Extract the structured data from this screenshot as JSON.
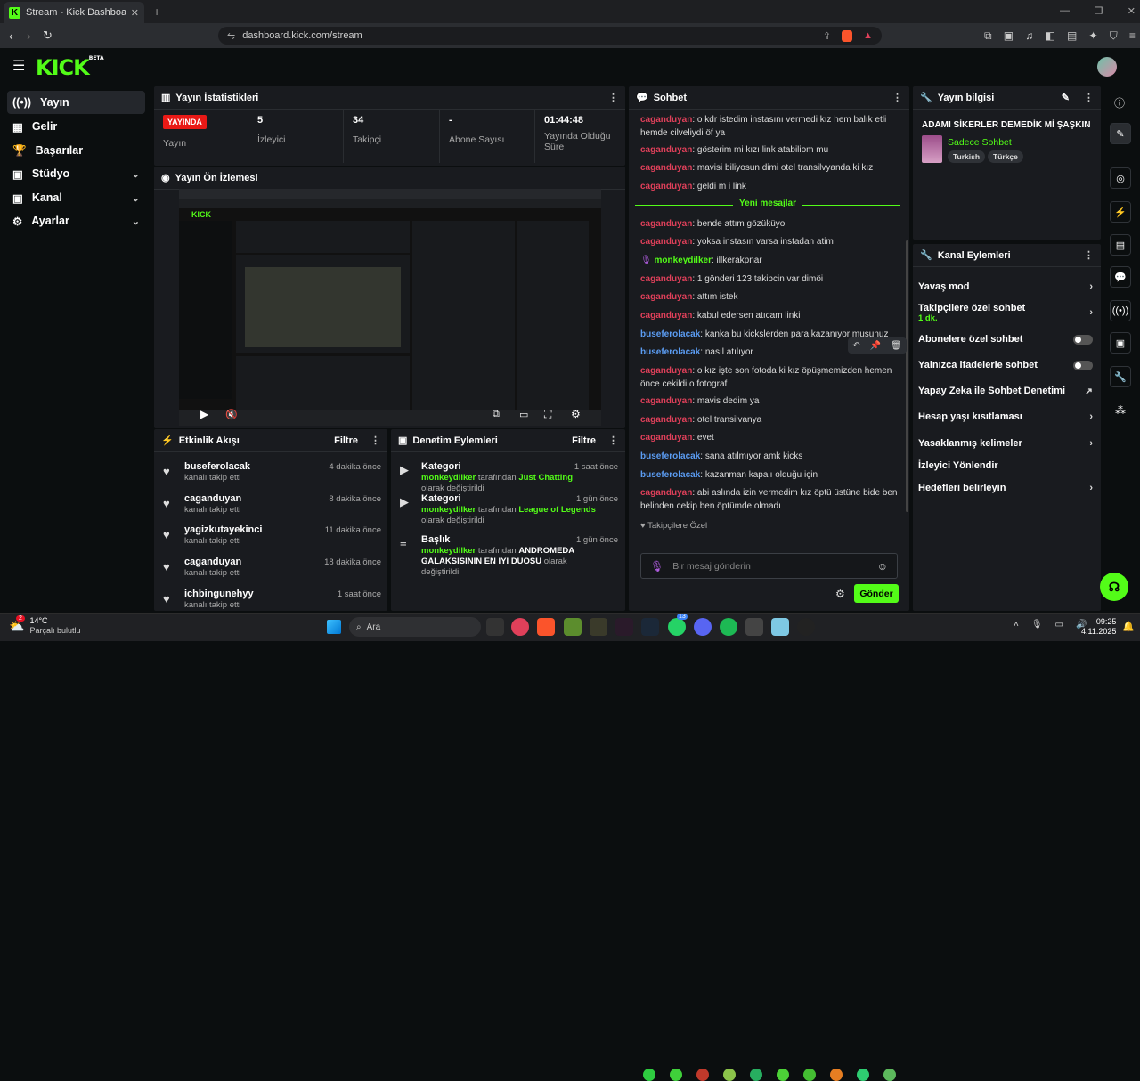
{
  "browser": {
    "tab_title": "Stream - Kick Dashboard",
    "url": "dashboard.kick.com/stream"
  },
  "app": {
    "logo": "KICK",
    "logo_badge": "BETA"
  },
  "sidebar": {
    "items": [
      {
        "label": "Yayın",
        "icon": "broadcast-icon"
      },
      {
        "label": "Gelir",
        "icon": "revenue-icon"
      },
      {
        "label": "Başarılar",
        "icon": "trophy-icon"
      },
      {
        "label": "Stüdyo",
        "icon": "studio-icon"
      },
      {
        "label": "Kanal",
        "icon": "channel-icon"
      },
      {
        "label": "Ayarlar",
        "icon": "gear-icon"
      }
    ]
  },
  "stats": {
    "title": "Yayın İstatistikleri",
    "live_badge": "YAYINDA",
    "items": [
      {
        "label": "Yayın",
        "value": ""
      },
      {
        "label": "İzleyici",
        "value": "5"
      },
      {
        "label": "Takipçi",
        "value": "34"
      },
      {
        "label": "Abone Sayısı",
        "value": "-"
      },
      {
        "label": "Yayında Olduğu Süre",
        "value": "01:44:48"
      }
    ]
  },
  "preview": {
    "title": "Yayın Ön İzlemesi"
  },
  "activity": {
    "title": "Etkinlik Akışı",
    "filter": "Filtre",
    "items": [
      {
        "name": "buseferolacak",
        "sub": "kanalı takip etti",
        "time": "4 dakika önce"
      },
      {
        "name": "caganduyan",
        "sub": "kanalı takip etti",
        "time": "8 dakika önce"
      },
      {
        "name": "yagizkutayekinci",
        "sub": "kanalı takip etti",
        "time": "11 dakika önce"
      },
      {
        "name": "caganduyan",
        "sub": "kanalı takip etti",
        "time": "18 dakika önce"
      },
      {
        "name": "ichbingunehyy",
        "sub": "kanalı takip etti",
        "time": "1 saat önce"
      }
    ]
  },
  "moderation": {
    "title": "Denetim Eylemleri",
    "filter": "Filtre",
    "items": [
      {
        "name": "Kategori",
        "time": "1 saat önce",
        "user": "monkeydilker",
        "mid": "tarafından",
        "value": "Just Chatting",
        "end": "olarak değiştirildi"
      },
      {
        "name": "Kategori",
        "time": "1 gün önce",
        "user": "monkeydilker",
        "mid": "tarafından",
        "value": "League of Legends",
        "end": "olarak değiştirildi"
      },
      {
        "name": "Başlık",
        "time": "1 gün önce",
        "user": "monkeydilker",
        "mid": "tarafından",
        "value": "ANDROMEDA GALAKSİSİNİN EN İYİ DUOSU",
        "end": "olarak değiştirildi"
      }
    ]
  },
  "chat": {
    "title": "Sohbet",
    "new_messages": "Yeni mesajlar",
    "messages": [
      {
        "user": "caganduyan",
        "text": ": o kdr istedim instasını vermedi kız hem balık etli hemde cilveliydi öf ya"
      },
      {
        "user": "caganduyan",
        "text": ": gösterim mi kızı link atabiliom mu"
      },
      {
        "user": "caganduyan",
        "text": ": mavisi biliyosun dimi otel transilvyanda ki kız"
      },
      {
        "user": "caganduyan",
        "text": ": geldi m i link"
      },
      {
        "user": "caganduyan",
        "text": ": bende attım gözüküyo"
      },
      {
        "user": "caganduyan",
        "text": ": yoksa instasın varsa instadan atim"
      },
      {
        "user": "monkeydilker",
        "text": ": illkerakpnar"
      },
      {
        "user": "caganduyan",
        "text": ": 1 gönderi 123 takipcin var dimöi"
      },
      {
        "user": "caganduyan",
        "text": ": attım istek"
      },
      {
        "user": "caganduyan",
        "text": ": kabul edersen atıcam linki"
      },
      {
        "user": "buseferolacak",
        "text": ": kanka bu kickslerden para kazanıyor musunuz"
      },
      {
        "user": "buseferolacak",
        "text": ": nasıl atılıyor"
      },
      {
        "user": "caganduyan",
        "text": ": o kız işte son fotoda ki kız öpüşmemizden hemen önce cekildi o fotograf"
      },
      {
        "user": "caganduyan",
        "text": ": mavis dedim ya"
      },
      {
        "user": "caganduyan",
        "text": ": otel transilvanya"
      },
      {
        "user": "caganduyan",
        "text": ": evet"
      },
      {
        "user": "buseferolacak",
        "text": ": sana atılmıyor amk kicks"
      },
      {
        "user": "buseferolacak",
        "text": ": kazanman kapalı olduğu için"
      },
      {
        "user": "caganduyan",
        "text": ": abi aslında izin vermedim kız öptü üstüne bide ben belinden cekip ben öptümde olmadı"
      }
    ],
    "followers_only": "Takipçilere Özel",
    "input_placeholder": "Bir mesaj gönderin",
    "send": "Gönder"
  },
  "stream_info": {
    "title": "Yayın bilgisi",
    "stream_title": "ADAMI SİKERLER DEMEDİK Mİ ŞAŞKIN",
    "category": "Sadece Sohbet",
    "tags": [
      "Turkish",
      "Türkçe"
    ]
  },
  "channel_actions": {
    "title": "Kanal Eylemleri",
    "items": [
      {
        "label": "Yavaş mod"
      },
      {
        "label": "Takipçilere özel sohbet",
        "sub": "1 dk."
      },
      {
        "label": "Abonelere özel sohbet"
      },
      {
        "label": "Yalnızca ifadelerle sohbet"
      },
      {
        "label": "Yapay Zeka ile Sohbet Denetimi"
      },
      {
        "label": "Hesap yaşı kısıtlaması"
      },
      {
        "label": "Yasaklanmış kelimeler"
      },
      {
        "label": "İzleyici Yönlendir"
      },
      {
        "label": "Hedefleri belirleyin"
      }
    ]
  },
  "taskbar": {
    "weather_temp": "14°C",
    "weather_desc": "Parçalı bulutlu",
    "search": "Ara",
    "time": "09:25",
    "date": "4.11.2025",
    "badge_weather": "2",
    "badge_app": "13"
  },
  "colors": {
    "accent": "#53fc18",
    "live": "#e91916",
    "user_red": "#e0405a",
    "user_blue": "#5b9cf2"
  }
}
